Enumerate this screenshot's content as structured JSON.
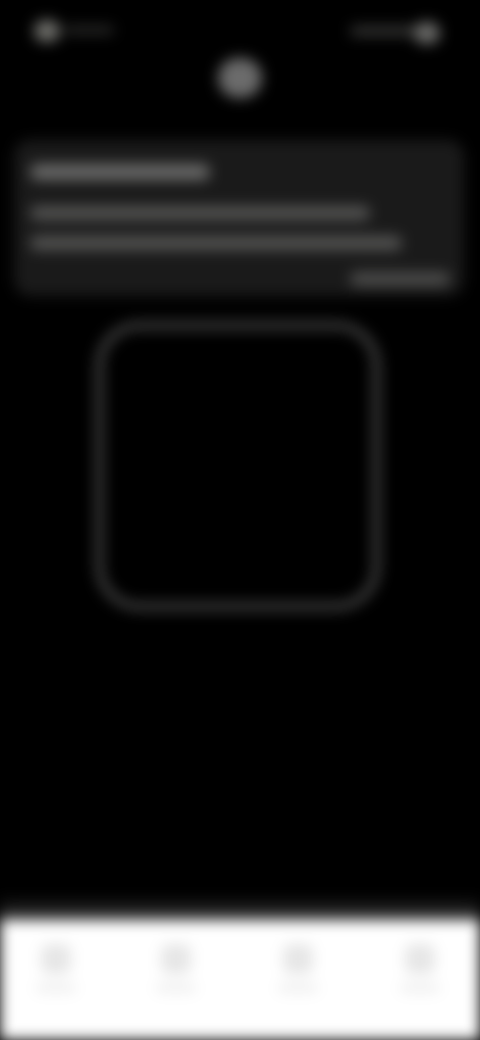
{
  "status_bar": {
    "time": "",
    "time_icon": "clock-indicator-icon",
    "signal_icon": "signal-wifi-icon",
    "battery_icon": "battery-icon"
  },
  "header": {
    "flash_icon": "flash-icon"
  },
  "info_card": {
    "title": "",
    "body_line_1": "",
    "body_line_2": "",
    "link": ""
  },
  "scanner": {
    "frame_icon": "scan-frame"
  },
  "bottom_nav": {
    "items": [
      {
        "label": "",
        "icon": "nav-icon-1"
      },
      {
        "label": "",
        "icon": "nav-icon-2"
      },
      {
        "label": "",
        "icon": "nav-icon-3"
      },
      {
        "label": "",
        "icon": "nav-icon-4"
      }
    ]
  },
  "colors": {
    "background": "#000000",
    "card": "#1a1a1a",
    "frame": "#4a4a4a",
    "nav_background": "#ffffff"
  }
}
